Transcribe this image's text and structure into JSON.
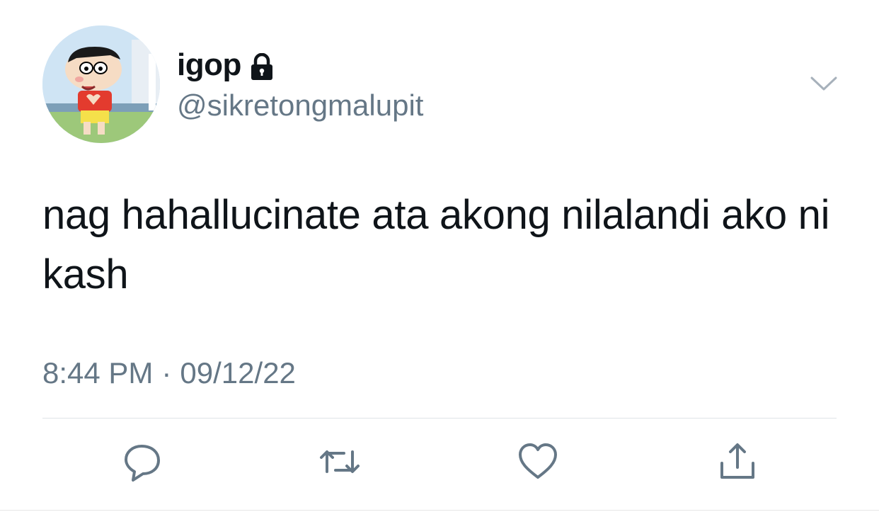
{
  "user": {
    "display_name": "igop",
    "handle": "@sikretongmalupit",
    "protected": true,
    "avatar": "cartoon-boy-avatar"
  },
  "tweet": {
    "text": "nag hahallucinate ata akong nilalandi ako ni kash",
    "time": "8:44 PM",
    "separator": "·",
    "date": "09/12/22"
  },
  "icons": {
    "lock": "lock-icon",
    "caret": "chevron-down-icon",
    "reply": "reply-icon",
    "retweet": "retweet-icon",
    "like": "heart-icon",
    "share": "share-icon"
  },
  "colors": {
    "text": "#0f1419",
    "secondary": "#657786",
    "divider": "#dfe3e7"
  }
}
